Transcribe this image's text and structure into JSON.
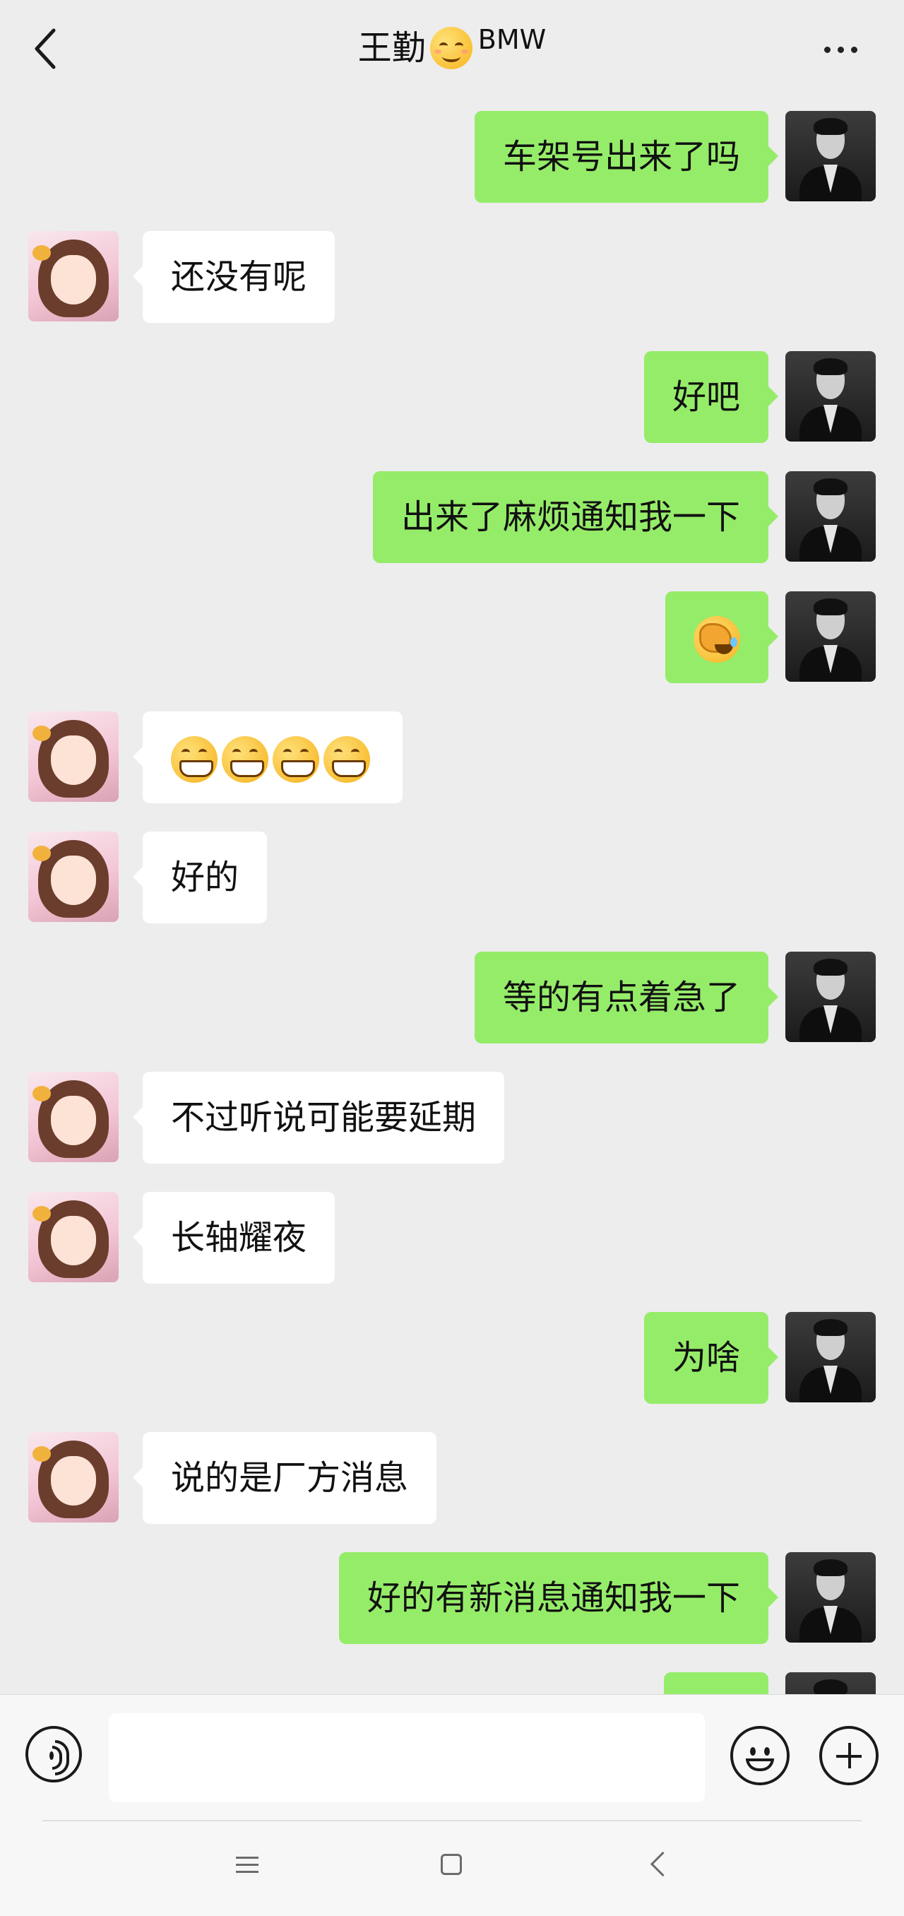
{
  "header": {
    "back_icon": "chevron-left-icon",
    "title_name": "王勤",
    "title_emoji": "smiling-face-icon",
    "title_suffix": "BMW",
    "more_icon": "more-dots-icon"
  },
  "messages": [
    {
      "from": "me",
      "text": "车架号出来了吗"
    },
    {
      "from": "other",
      "text": "还没有呢"
    },
    {
      "from": "me",
      "text": "好吧"
    },
    {
      "from": "me",
      "text": "出来了麻烦通知我一下"
    },
    {
      "from": "me",
      "emoji": [
        "facepalm-crying-emoji"
      ]
    },
    {
      "from": "other",
      "emoji": [
        "grinning-emoji",
        "grinning-emoji",
        "grinning-emoji",
        "grinning-emoji"
      ]
    },
    {
      "from": "other",
      "text": "好的"
    },
    {
      "from": "me",
      "text": "等的有点着急了"
    },
    {
      "from": "other",
      "text": "不过听说可能要延期"
    },
    {
      "from": "other",
      "text": "长轴耀夜"
    },
    {
      "from": "me",
      "text": "为啥"
    },
    {
      "from": "other",
      "text": "说的是厂方消息"
    },
    {
      "from": "me",
      "text": "好的有新消息通知我一下"
    },
    {
      "from": "me",
      "text": ""
    }
  ],
  "input_bar": {
    "voice_icon": "voice-icon",
    "input_value": "",
    "emoji_icon": "emoji-icon",
    "plus_icon": "plus-icon"
  },
  "nav_bar": {
    "menu_icon": "menu-icon",
    "home_icon": "home-icon",
    "back_icon": "back-icon"
  },
  "colors": {
    "background": "#ededed",
    "my_bubble": "#95ec69",
    "other_bubble": "#ffffff"
  }
}
